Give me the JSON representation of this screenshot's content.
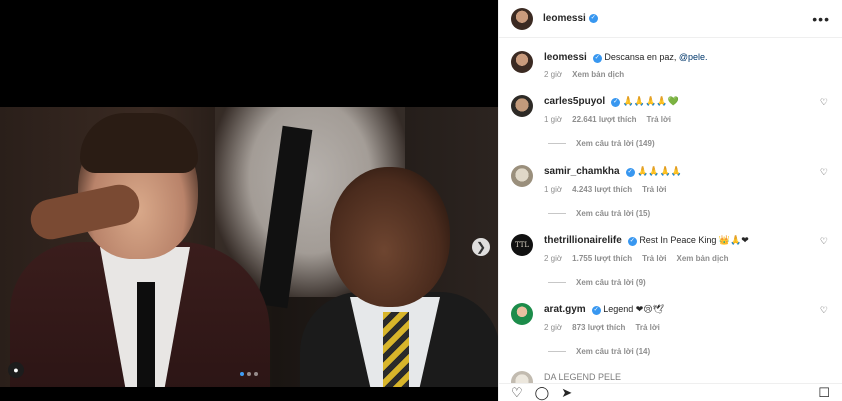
{
  "post": {
    "author": "leomessi",
    "more_icon": "more-horizontal-icon",
    "caption": {
      "user": "leomessi",
      "text": "Descansa en paz, ",
      "mention": "@pele.",
      "time": "2 giờ",
      "translate": "Xem bản dịch"
    },
    "media": {
      "dots_active_index": 0,
      "dots_count": 3
    }
  },
  "comments": [
    {
      "user": "carles5puyol",
      "text": "",
      "emoji": "🙏🙏🙏🙏💚",
      "time": "1 giờ",
      "likes": "22.641 lượt thích",
      "reply": "Trả lời",
      "translate": "",
      "replies": "Xem câu trả lời (149)"
    },
    {
      "user": "samir_chamkha",
      "text": "",
      "emoji": "🙏🙏🙏🙏",
      "time": "1 giờ",
      "likes": "4.243 lượt thích",
      "reply": "Trả lời",
      "translate": "",
      "replies": "Xem câu trả lời (15)"
    },
    {
      "user": "thetrillionairelife",
      "text": "Rest In Peace King ",
      "emoji": "👑🙏❤",
      "time": "2 giờ",
      "likes": "1.755 lượt thích",
      "reply": "Trả lời",
      "translate": "Xem bản dịch",
      "replies": "Xem câu trả lời (9)"
    },
    {
      "user": "arat.gym",
      "text": "Legend ",
      "emoji": "❤😢🕊",
      "time": "2 giờ",
      "likes": "873 lượt thích",
      "reply": "Trả lời",
      "translate": "",
      "replies": "Xem câu trả lời (14)"
    }
  ],
  "partial_comment": {
    "text": "DA LEGEND PELE"
  },
  "avatar_ttl_text": "TTL"
}
